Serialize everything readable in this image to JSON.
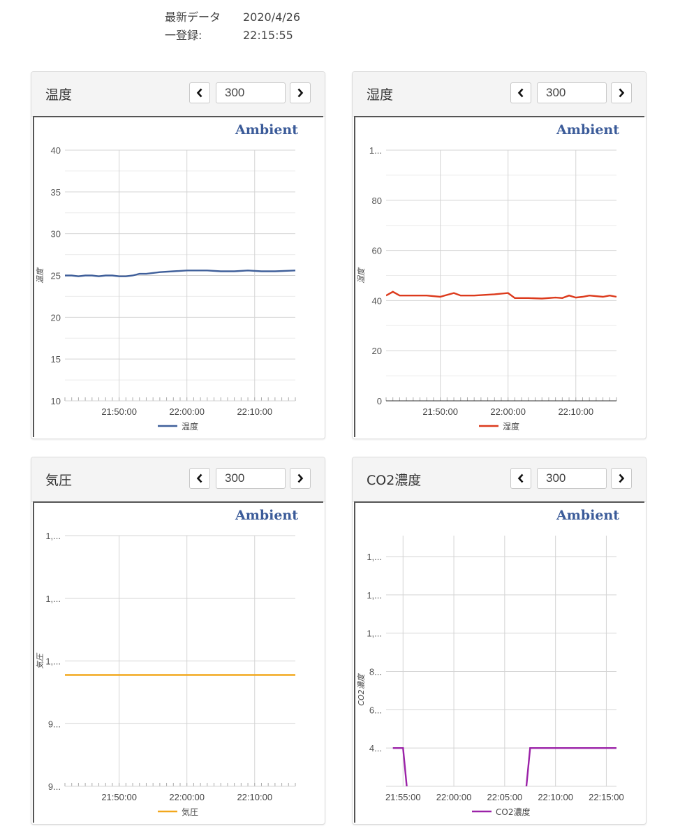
{
  "header": {
    "latest_label_1": "最新データ",
    "latest_label_2": "一登録:",
    "date": "2020/4/26",
    "time": "22:15:55"
  },
  "panels": [
    {
      "title": "温度",
      "range_value": "300",
      "brand": "Ambient",
      "ylabel": "温度",
      "legend": "温度",
      "color": "#3f5f9a",
      "y_ticks": [
        "40",
        "35",
        "30",
        "25",
        "20",
        "15",
        "10"
      ],
      "x_ticks": [
        "21:50:00",
        "22:00:00",
        "22:10:00"
      ]
    },
    {
      "title": "湿度",
      "range_value": "300",
      "brand": "Ambient",
      "ylabel": "湿度",
      "legend": "湿度",
      "color": "#dc3a1c",
      "y_ticks": [
        "1...",
        "80",
        "60",
        "40",
        "20",
        "0"
      ],
      "x_ticks": [
        "21:50:00",
        "22:00:00",
        "22:10:00"
      ]
    },
    {
      "title": "気圧",
      "range_value": "300",
      "brand": "Ambient",
      "ylabel": "気圧",
      "legend": "気圧",
      "color": "#f2a71c",
      "y_ticks": [
        "1,...",
        "1,...",
        "1,...",
        "9...",
        "9..."
      ],
      "x_ticks": [
        "21:50:00",
        "22:00:00",
        "22:10:00"
      ]
    },
    {
      "title": "CO2濃度",
      "range_value": "300",
      "brand": "Ambient",
      "ylabel": "CO2濃度",
      "legend": "CO2濃度",
      "color": "#9b22a8",
      "y_ticks": [
        "1,...",
        "1,...",
        "1,...",
        "8...",
        "6...",
        "4..."
      ],
      "x_ticks": [
        "21:55:00",
        "22:00:00",
        "22:05:00",
        "22:10:00",
        "22:15:00"
      ]
    }
  ],
  "chart_data": [
    {
      "type": "line",
      "ylabel": "温度",
      "ylim": [
        10,
        40
      ],
      "x": [
        "21:42",
        "21:43",
        "21:44",
        "21:45",
        "21:46",
        "21:47",
        "21:48",
        "21:49",
        "21:50",
        "21:51",
        "21:52",
        "21:53",
        "21:54",
        "21:56",
        "21:58",
        "22:00",
        "22:01",
        "22:03",
        "22:05",
        "22:07",
        "22:09",
        "22:11",
        "22:13",
        "22:16"
      ],
      "series": [
        {
          "name": "温度",
          "values": [
            25.0,
            25.0,
            24.9,
            25.0,
            25.0,
            24.9,
            25.0,
            25.0,
            24.9,
            24.9,
            25.0,
            25.2,
            25.2,
            25.4,
            25.5,
            25.6,
            25.6,
            25.6,
            25.5,
            25.5,
            25.6,
            25.5,
            25.5,
            25.6
          ]
        }
      ]
    },
    {
      "type": "line",
      "ylabel": "湿度",
      "ylim": [
        0,
        100
      ],
      "x": [
        "21:42",
        "21:43",
        "21:44",
        "21:45",
        "21:46",
        "21:48",
        "21:50",
        "21:52",
        "21:53",
        "21:55",
        "21:58",
        "22:00",
        "22:01",
        "22:03",
        "22:05",
        "22:07",
        "22:08",
        "22:09",
        "22:10",
        "22:11",
        "22:12",
        "22:14",
        "22:15",
        "22:16"
      ],
      "series": [
        {
          "name": "湿度",
          "values": [
            42,
            43.5,
            42,
            42,
            42,
            42,
            41.5,
            43,
            42,
            42,
            42.5,
            43,
            41,
            41,
            40.8,
            41.2,
            41,
            42,
            41.2,
            41.5,
            42,
            41.5,
            42,
            41.5
          ]
        }
      ]
    },
    {
      "type": "line",
      "ylabel": "気圧",
      "ylim": [
        0,
        1
      ],
      "x": [
        "21:42",
        "21:50",
        "22:00",
        "22:10",
        "22:16"
      ],
      "series": [
        {
          "name": "気圧",
          "values": [
            0.5,
            0.5,
            0.5,
            0.5,
            0.5
          ]
        }
      ]
    },
    {
      "type": "line",
      "ylabel": "CO2濃度",
      "ylim": [
        0,
        1
      ],
      "x": [
        "21:54",
        "21:55",
        "21:55:30",
        "22:07",
        "22:07:30",
        "22:16"
      ],
      "series": [
        {
          "name": "CO2濃度",
          "values": [
            400,
            400,
            0,
            0,
            400,
            400
          ]
        }
      ]
    }
  ]
}
